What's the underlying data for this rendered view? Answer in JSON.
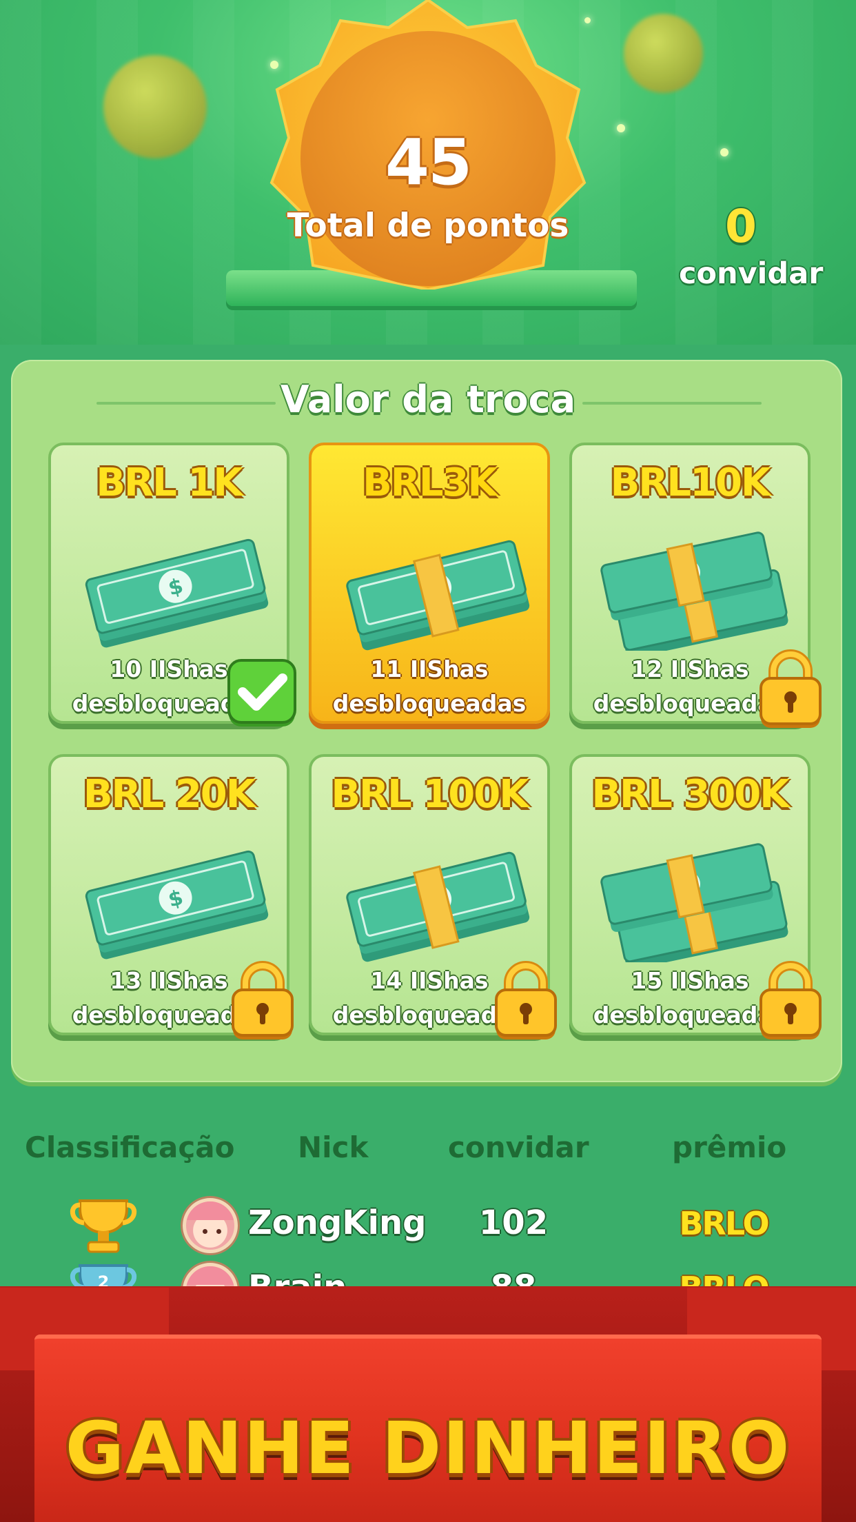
{
  "header": {
    "total_points_value": "45",
    "total_points_label": "Total de  pontos",
    "invite_count": "0",
    "invite_label": "convidar"
  },
  "exchange": {
    "title": "Valor da troca",
    "cards": [
      {
        "label": "BRL 1K",
        "info_line1": "10 IIShas",
        "info_line2": "desbloqueadas",
        "status": "claimed"
      },
      {
        "label": "BRL3K",
        "info_line1": "11 IIShas",
        "info_line2": "desbloqueadas",
        "status": "selected"
      },
      {
        "label": "BRL10K",
        "info_line1": "12 IIShas",
        "info_line2": "desbloqueadas",
        "status": "locked"
      },
      {
        "label": "BRL 20K",
        "info_line1": "13 IIShas",
        "info_line2": "desbloqueadas",
        "status": "locked"
      },
      {
        "label": "BRL 100K",
        "info_line1": "14 IIShas",
        "info_line2": "desbloqueadas",
        "status": "locked"
      },
      {
        "label": "BRL 300K",
        "info_line1": "15 IIShas",
        "info_line2": "desbloqueadas",
        "status": "locked"
      }
    ]
  },
  "ranking": {
    "columns": [
      "Classificação",
      "Nick",
      "convidar",
      "prêmio"
    ],
    "rows": [
      {
        "rank_icon": "gold-trophy-icon",
        "nick": "ZongKing",
        "invites": "102",
        "prize": "BRLO"
      },
      {
        "rank_icon": "silver-trophy-icon",
        "nick": "Brain",
        "invites": "88",
        "prize": "BRLO"
      }
    ]
  },
  "banner": {
    "text": "GANHE DINHEIRO"
  },
  "colors": {
    "background_green": "#3aae6a",
    "panel_green": "#a8de85",
    "selected_yellow": "#ffe833",
    "banner_red": "#e0331f",
    "title_yellow": "#ffd21c"
  }
}
